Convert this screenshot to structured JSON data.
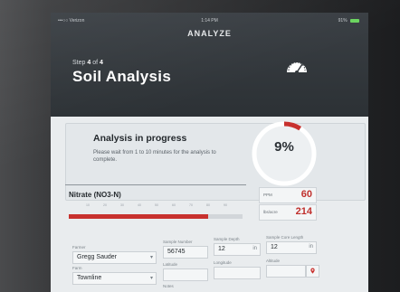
{
  "status_bar": {
    "carrier": "•••○○ Verizon",
    "time": "1:14 PM",
    "battery": "91%"
  },
  "header": {
    "nav_title": "ANALYZE",
    "step_prefix": "Step",
    "step_current": "4",
    "step_of": "of",
    "step_total": "4",
    "title": "Soil Analysis",
    "icon": "gauge-icon"
  },
  "progress": {
    "heading": "Analysis in progress",
    "subtext": "Please wait from 1 to 10 minutes for the analysis to complete.",
    "percent": 9,
    "percent_label": "9%"
  },
  "nitrate": {
    "label": "Nitrate (NO3-N)",
    "scale_ticks": [
      "10",
      "20",
      "30",
      "40",
      "50",
      "60",
      "70",
      "80",
      "90"
    ],
    "level": 0.8,
    "ppm_label": "PPM",
    "ppm_value": "60",
    "lbs_label": "lbs/acre",
    "lbs_value": "214"
  },
  "form": {
    "farmer_label": "Farmer",
    "farmer_value": "Gregg Sauder",
    "farm_label": "Farm",
    "farm_value": "Townline",
    "sample_number_label": "Sample Number",
    "sample_number_value": "56745",
    "sample_depth_label": "Sample Depth",
    "sample_depth_value": "12",
    "sample_depth_unit": "in",
    "core_length_label": "Sample Core Length",
    "core_length_value": "12",
    "core_length_unit": "in",
    "latitude_label": "Latitude",
    "longitude_label": "Longitude",
    "altitude_label": "Altitude",
    "notes_label": "Notes"
  },
  "colors": {
    "accent": "#c8312e",
    "header_bg": "#33383d",
    "screen_bg": "#e9ecee"
  }
}
